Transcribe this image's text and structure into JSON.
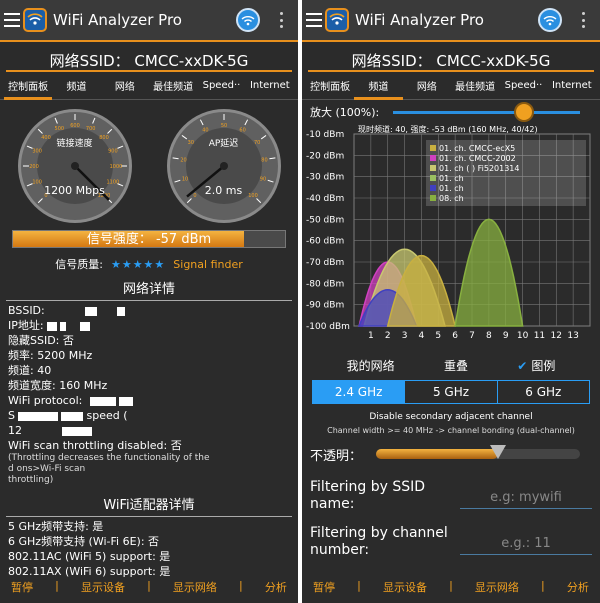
{
  "app": {
    "title": "WiFi Analyzer Pro",
    "ssid_line": "网络SSID：  CMCC-xxDK-5G"
  },
  "tabs_left": [
    "控制面板",
    "频道",
    "网络",
    "最佳频道",
    "Speed··",
    "Internet"
  ],
  "tabs_right": [
    "控制面板",
    "频道",
    "网络",
    "最佳频道",
    "Speed··",
    "Internet"
  ],
  "gauges": {
    "link": {
      "label": "链接速度",
      "value": "1200 Mbps",
      "ticks": [
        "0",
        "100",
        "200",
        "300",
        "400",
        "500",
        "600",
        "700",
        "800",
        "900",
        "1000",
        "1100",
        "1200"
      ],
      "needle_fraction": 1.0
    },
    "ap": {
      "label": "AP延迟",
      "value": "2.0 ms",
      "ticks": [
        "0",
        "10",
        "20",
        "30",
        "40",
        "50",
        "60",
        "70",
        "80",
        "90",
        "100"
      ],
      "needle_fraction": 0.02
    }
  },
  "signal": {
    "text": "信号强度：  -57 dBm",
    "fraction": 0.85
  },
  "quality": {
    "label": "信号质量:",
    "stars": "★★★★★",
    "finder": "Signal finder"
  },
  "network_details": {
    "title": "网络详情",
    "rows": [
      {
        "k": "BSSID:",
        "v": ""
      },
      {
        "k": "IP地址:",
        "v": ""
      },
      {
        "k": "隐藏SSID:",
        "v": "否"
      },
      {
        "k": "频率:",
        "v": "5200 MHz"
      },
      {
        "k": "频道:",
        "v": "40"
      },
      {
        "k": "频道宽度:",
        "v": "160 MHz"
      },
      {
        "k": "WiFi protocol:",
        "v": ""
      },
      {
        "k": "S",
        "v": "speed ("
      },
      {
        "k": "12",
        "v": ""
      },
      {
        "k": "WiFi scan throttling disabled:",
        "v": "否"
      }
    ],
    "throttle_note": "(Throttling decreases the functionality of the",
    "throttle_note2": "d                                              ons>Wi-Fi scan",
    "throttle_note3": "throttling)"
  },
  "adapter_details": {
    "title": "WiFi适配器详情",
    "rows": [
      "5 GHz频带支持: 是",
      "6 GHz频带支持 (Wi-Fi 6E): 否",
      "802.11AC (WiFi 5) support: 是",
      "802.11AX (WiFi 6) support: 是"
    ]
  },
  "bottom_nav": [
    "暂停",
    "显示设备",
    "显示网络",
    "分析"
  ],
  "right": {
    "zoom_label": "放大 (100%):",
    "zoom_fraction": 0.7,
    "current_line": "现时频道: 40,  强度: -53 dBm (160 MHz, 40/42)",
    "legend": [
      {
        "text": "01. ch. CMCC-ecX5",
        "color": "#c8b040"
      },
      {
        "text": "01. ch. CMCC-2002",
        "color": "#d040c0"
      },
      {
        "text": "01. ch  (  ) Fi5201314",
        "color": "#c8c870"
      },
      {
        "text": "01. ch",
        "color": "#9ac060"
      },
      {
        "text": "01. ch",
        "color": "#4040c0"
      },
      {
        "text": "08. ch",
        "color": "#88b040"
      }
    ],
    "my_network": "我的网络",
    "overlap": "重叠",
    "legend_toggle": "图例",
    "bands": [
      "2.4 GHz",
      "5 GHz",
      "6 GHz"
    ],
    "secondary_note": "Disable secondary adjacent channel",
    "bonding_note": "Channel width >= 40 MHz -> channel bonding (dual-channel)",
    "opacity_label": "不透明：",
    "opacity_fraction": 0.6,
    "filter_ssid_label": "Filtering by SSID name:",
    "filter_ssid_placeholder": "e.g: mywifi",
    "filter_channel_label": "Filtering by channel number:",
    "filter_channel_placeholder": "e.g.: 11"
  },
  "chart_data": {
    "type": "area",
    "x_ticks": [
      "1",
      "2",
      "3",
      "4",
      "5",
      "6",
      "7",
      "8",
      "9",
      "10",
      "11",
      "12",
      "13"
    ],
    "y_ticks": [
      "-10 dBm",
      "-20 dBm",
      "-30 dBm",
      "-40 dBm",
      "-50 dBm",
      "-60 dBm",
      "-70 dBm",
      "-80 dBm",
      "-90 dBm",
      "-100 dBm"
    ],
    "ylim": [
      -100,
      -10
    ],
    "xlim": [
      0,
      14
    ],
    "series": [
      {
        "center": 2,
        "peak": -70,
        "half_width": 1.7,
        "color": "#d040c0"
      },
      {
        "center": 3,
        "peak": -64,
        "half_width": 2.4,
        "color": "#c8c870"
      },
      {
        "center": 2,
        "peak": -83,
        "half_width": 1.7,
        "color": "#4040c0"
      },
      {
        "center": 4,
        "peak": -67,
        "half_width": 2.0,
        "color": "#c8b040"
      },
      {
        "center": 8,
        "peak": -50,
        "half_width": 2.0,
        "color": "#88b040"
      }
    ]
  }
}
